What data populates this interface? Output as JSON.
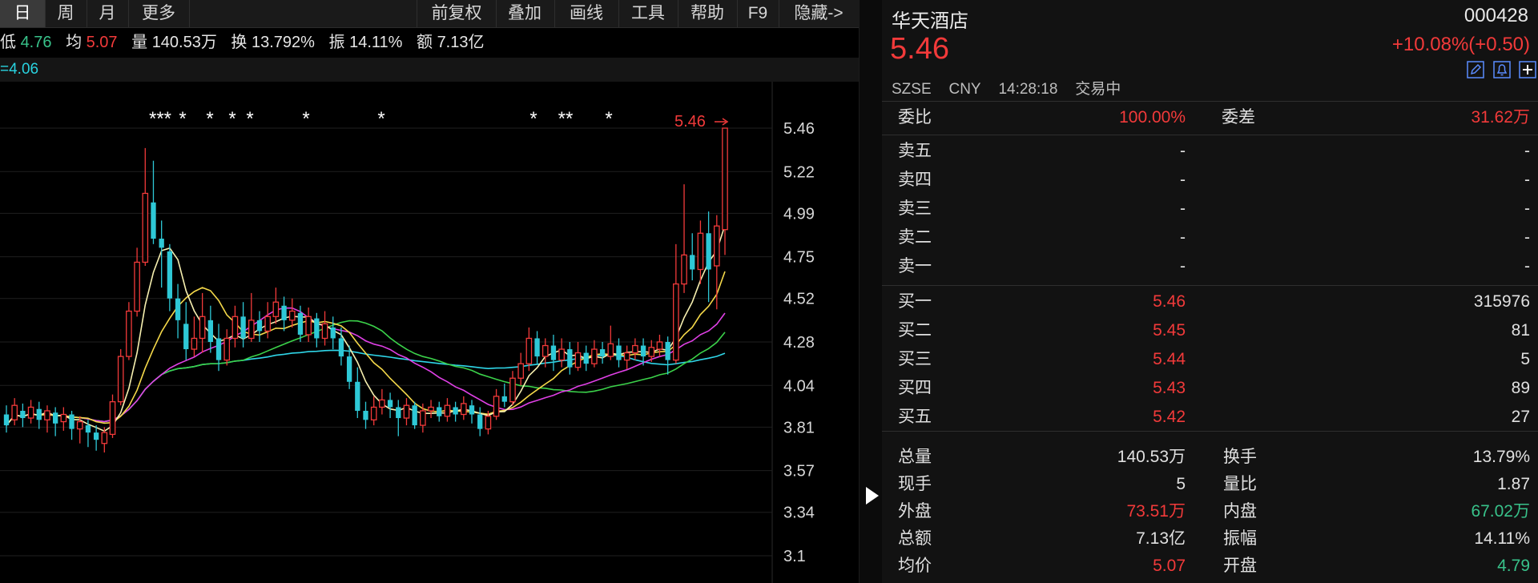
{
  "toolbar": {
    "tabs": [
      "日",
      "周",
      "月",
      "更多"
    ],
    "actions": [
      "前复权",
      "叠加",
      "画线",
      "工具",
      "帮助",
      "F9",
      "隐藏->"
    ]
  },
  "info": {
    "low_label": "低",
    "low_value": "4.76",
    "avg_label": "均",
    "avg_value": "5.07",
    "vol_label": "量",
    "vol_value": "140.53万",
    "turnover_label": "换",
    "turnover_value": "13.792%",
    "amplitude_label": "振",
    "amplitude_value": "14.11%",
    "amount_label": "额",
    "amount_value": "7.13亿"
  },
  "ma_row": {
    "text": "=4.06"
  },
  "chart_data": {
    "type": "candlestick",
    "y_ticks": [
      "5.46",
      "5.22",
      "4.99",
      "4.75",
      "4.52",
      "4.28",
      "4.04",
      "3.81",
      "3.57",
      "3.34",
      "3.1"
    ],
    "ylim": [
      3.05,
      5.55
    ],
    "last_price_marker": "5.46",
    "star_markers": [
      "***",
      "*",
      "*",
      "*",
      "*",
      "*",
      "*",
      "*",
      "**",
      "*"
    ],
    "candles": [
      {
        "o": 3.88,
        "c": 3.82,
        "h": 3.93,
        "l": 3.78
      },
      {
        "o": 3.85,
        "c": 3.93,
        "h": 3.97,
        "l": 3.82
      },
      {
        "o": 3.9,
        "c": 3.86,
        "h": 3.94,
        "l": 3.81
      },
      {
        "o": 3.86,
        "c": 3.92,
        "h": 3.96,
        "l": 3.83
      },
      {
        "o": 3.91,
        "c": 3.85,
        "h": 3.95,
        "l": 3.8
      },
      {
        "o": 3.85,
        "c": 3.9,
        "h": 3.93,
        "l": 3.78
      },
      {
        "o": 3.89,
        "c": 3.83,
        "h": 3.92,
        "l": 3.76
      },
      {
        "o": 3.84,
        "c": 3.88,
        "h": 3.92,
        "l": 3.79
      },
      {
        "o": 3.88,
        "c": 3.8,
        "h": 3.9,
        "l": 3.74
      },
      {
        "o": 3.8,
        "c": 3.84,
        "h": 3.87,
        "l": 3.72
      },
      {
        "o": 3.82,
        "c": 3.78,
        "h": 3.85,
        "l": 3.7
      },
      {
        "o": 3.78,
        "c": 3.74,
        "h": 3.82,
        "l": 3.68
      },
      {
        "o": 3.72,
        "c": 3.78,
        "h": 3.81,
        "l": 3.67
      },
      {
        "o": 3.77,
        "c": 3.95,
        "h": 3.99,
        "l": 3.75
      },
      {
        "o": 3.95,
        "c": 4.2,
        "h": 4.24,
        "l": 3.93
      },
      {
        "o": 4.2,
        "c": 4.45,
        "h": 4.5,
        "l": 4.18
      },
      {
        "o": 4.45,
        "c": 4.72,
        "h": 4.8,
        "l": 4.42
      },
      {
        "o": 4.72,
        "c": 5.1,
        "h": 5.35,
        "l": 4.7
      },
      {
        "o": 5.05,
        "c": 4.85,
        "h": 5.28,
        "l": 4.82
      },
      {
        "o": 4.85,
        "c": 4.8,
        "h": 4.95,
        "l": 4.58
      },
      {
        "o": 4.78,
        "c": 4.52,
        "h": 4.82,
        "l": 4.45
      },
      {
        "o": 4.52,
        "c": 4.4,
        "h": 4.6,
        "l": 4.3
      },
      {
        "o": 4.38,
        "c": 4.24,
        "h": 4.5,
        "l": 4.18
      },
      {
        "o": 4.24,
        "c": 4.3,
        "h": 4.42,
        "l": 4.2
      },
      {
        "o": 4.3,
        "c": 4.42,
        "h": 4.55,
        "l": 4.22
      },
      {
        "o": 4.4,
        "c": 4.28,
        "h": 4.48,
        "l": 4.22
      },
      {
        "o": 4.3,
        "c": 4.18,
        "h": 4.38,
        "l": 4.12
      },
      {
        "o": 4.18,
        "c": 4.3,
        "h": 4.35,
        "l": 4.15
      },
      {
        "o": 4.3,
        "c": 4.42,
        "h": 4.48,
        "l": 4.25
      },
      {
        "o": 4.42,
        "c": 4.3,
        "h": 4.5,
        "l": 4.25
      },
      {
        "o": 4.3,
        "c": 4.4,
        "h": 4.55,
        "l": 4.28
      },
      {
        "o": 4.4,
        "c": 4.34,
        "h": 4.45,
        "l": 4.28
      },
      {
        "o": 4.34,
        "c": 4.42,
        "h": 4.5,
        "l": 4.3
      },
      {
        "o": 4.42,
        "c": 4.5,
        "h": 4.58,
        "l": 4.38
      },
      {
        "o": 4.48,
        "c": 4.4,
        "h": 4.53,
        "l": 4.34
      },
      {
        "o": 4.4,
        "c": 4.45,
        "h": 4.52,
        "l": 4.36
      },
      {
        "o": 4.44,
        "c": 4.32,
        "h": 4.48,
        "l": 4.28
      },
      {
        "o": 4.32,
        "c": 4.42,
        "h": 4.47,
        "l": 4.28
      },
      {
        "o": 4.41,
        "c": 4.3,
        "h": 4.44,
        "l": 4.25
      },
      {
        "o": 4.3,
        "c": 4.38,
        "h": 4.45,
        "l": 4.26
      },
      {
        "o": 4.36,
        "c": 4.3,
        "h": 4.42,
        "l": 4.24
      },
      {
        "o": 4.3,
        "c": 4.2,
        "h": 4.36,
        "l": 4.15
      },
      {
        "o": 4.2,
        "c": 4.06,
        "h": 4.26,
        "l": 4.02
      },
      {
        "o": 4.06,
        "c": 3.9,
        "h": 4.14,
        "l": 3.86
      },
      {
        "o": 3.9,
        "c": 3.85,
        "h": 3.95,
        "l": 3.8
      },
      {
        "o": 3.85,
        "c": 3.92,
        "h": 3.98,
        "l": 3.82
      },
      {
        "o": 3.92,
        "c": 3.96,
        "h": 4.02,
        "l": 3.88
      },
      {
        "o": 3.96,
        "c": 3.92,
        "h": 4.0,
        "l": 3.86
      },
      {
        "o": 3.92,
        "c": 3.86,
        "h": 3.96,
        "l": 3.76
      },
      {
        "o": 3.86,
        "c": 3.93,
        "h": 3.97,
        "l": 3.82
      },
      {
        "o": 3.93,
        "c": 3.82,
        "h": 3.95,
        "l": 3.8
      },
      {
        "o": 3.82,
        "c": 3.9,
        "h": 3.94,
        "l": 3.78
      },
      {
        "o": 3.9,
        "c": 3.92,
        "h": 3.96,
        "l": 3.86
      },
      {
        "o": 3.92,
        "c": 3.87,
        "h": 3.95,
        "l": 3.84
      },
      {
        "o": 3.87,
        "c": 3.93,
        "h": 3.97,
        "l": 3.84
      },
      {
        "o": 3.92,
        "c": 3.88,
        "h": 3.95,
        "l": 3.84
      },
      {
        "o": 3.88,
        "c": 3.94,
        "h": 3.98,
        "l": 3.85
      },
      {
        "o": 3.93,
        "c": 3.88,
        "h": 3.96,
        "l": 3.83
      },
      {
        "o": 3.88,
        "c": 3.8,
        "h": 3.92,
        "l": 3.76
      },
      {
        "o": 3.8,
        "c": 3.87,
        "h": 3.9,
        "l": 3.77
      },
      {
        "o": 3.87,
        "c": 3.98,
        "h": 4.02,
        "l": 3.85
      },
      {
        "o": 3.98,
        "c": 3.95,
        "h": 4.05,
        "l": 3.92
      },
      {
        "o": 3.95,
        "c": 4.08,
        "h": 4.12,
        "l": 3.93
      },
      {
        "o": 4.08,
        "c": 4.16,
        "h": 4.22,
        "l": 4.04
      },
      {
        "o": 4.16,
        "c": 4.3,
        "h": 4.36,
        "l": 4.12
      },
      {
        "o": 4.3,
        "c": 4.2,
        "h": 4.34,
        "l": 4.16
      },
      {
        "o": 4.2,
        "c": 4.26,
        "h": 4.3,
        "l": 4.14
      },
      {
        "o": 4.26,
        "c": 4.18,
        "h": 4.32,
        "l": 4.12
      },
      {
        "o": 4.18,
        "c": 4.24,
        "h": 4.3,
        "l": 4.14
      },
      {
        "o": 4.24,
        "c": 4.14,
        "h": 4.28,
        "l": 4.1
      },
      {
        "o": 4.14,
        "c": 4.22,
        "h": 4.28,
        "l": 4.12
      },
      {
        "o": 4.22,
        "c": 4.16,
        "h": 4.26,
        "l": 4.12
      },
      {
        "o": 4.16,
        "c": 4.24,
        "h": 4.29,
        "l": 4.14
      },
      {
        "o": 4.24,
        "c": 4.2,
        "h": 4.28,
        "l": 4.16
      },
      {
        "o": 4.2,
        "c": 4.27,
        "h": 4.37,
        "l": 4.18
      },
      {
        "o": 4.26,
        "c": 4.18,
        "h": 4.3,
        "l": 4.14
      },
      {
        "o": 4.18,
        "c": 4.22,
        "h": 4.26,
        "l": 4.13
      },
      {
        "o": 4.22,
        "c": 4.26,
        "h": 4.3,
        "l": 4.18
      },
      {
        "o": 4.26,
        "c": 4.2,
        "h": 4.3,
        "l": 4.15
      },
      {
        "o": 4.2,
        "c": 4.25,
        "h": 4.29,
        "l": 4.17
      },
      {
        "o": 4.24,
        "c": 4.28,
        "h": 4.32,
        "l": 4.2
      },
      {
        "o": 4.28,
        "c": 4.18,
        "h": 4.31,
        "l": 4.1
      },
      {
        "o": 4.18,
        "c": 4.6,
        "h": 4.82,
        "l": 4.16
      },
      {
        "o": 4.6,
        "c": 4.76,
        "h": 5.15,
        "l": 4.55
      },
      {
        "o": 4.76,
        "c": 4.68,
        "h": 4.88,
        "l": 4.62
      },
      {
        "o": 4.68,
        "c": 4.88,
        "h": 4.95,
        "l": 4.6
      },
      {
        "o": 4.88,
        "c": 4.68,
        "h": 5.0,
        "l": 4.5
      },
      {
        "o": 4.7,
        "c": 4.92,
        "h": 4.98,
        "l": 4.46
      },
      {
        "o": 4.9,
        "c": 5.46,
        "h": 5.46,
        "l": 4.76
      }
    ]
  },
  "quote": {
    "name": "华天酒店",
    "code": "000428",
    "price": "5.46",
    "change": "+10.08%(+0.50)",
    "market": "SZSE",
    "currency": "CNY",
    "time": "14:28:18",
    "status": "交易中"
  },
  "orderbook": {
    "ratio_label": "委比",
    "ratio_value": "100.00%",
    "diff_label": "委差",
    "diff_value": "31.62万",
    "asks": [
      {
        "label": "卖五",
        "price": "-",
        "vol": "-"
      },
      {
        "label": "卖四",
        "price": "-",
        "vol": "-"
      },
      {
        "label": "卖三",
        "price": "-",
        "vol": "-"
      },
      {
        "label": "卖二",
        "price": "-",
        "vol": "-"
      },
      {
        "label": "卖一",
        "price": "-",
        "vol": "-"
      }
    ],
    "bids": [
      {
        "label": "买一",
        "price": "5.46",
        "vol": "315976"
      },
      {
        "label": "买二",
        "price": "5.45",
        "vol": "81"
      },
      {
        "label": "买三",
        "price": "5.44",
        "vol": "5"
      },
      {
        "label": "买四",
        "price": "5.43",
        "vol": "89"
      },
      {
        "label": "买五",
        "price": "5.42",
        "vol": "27"
      }
    ]
  },
  "stats": [
    {
      "l1": "总量",
      "v1": "140.53万",
      "l2": "换手",
      "v2": "13.79%"
    },
    {
      "l1": "现手",
      "v1": "5",
      "l2": "量比",
      "v2": "1.87"
    },
    {
      "l1": "外盘",
      "v1": "73.51万",
      "l2": "内盘",
      "v2": "67.02万"
    },
    {
      "l1": "总额",
      "v1": "7.13亿",
      "l2": "振幅",
      "v2": "14.11%"
    },
    {
      "l1": "均价",
      "v1": "5.07",
      "l2": "开盘",
      "v2": "4.79"
    }
  ],
  "colors": {
    "up": "#f23a3a",
    "down": "#2ec8d6",
    "green": "#38c28a"
  }
}
